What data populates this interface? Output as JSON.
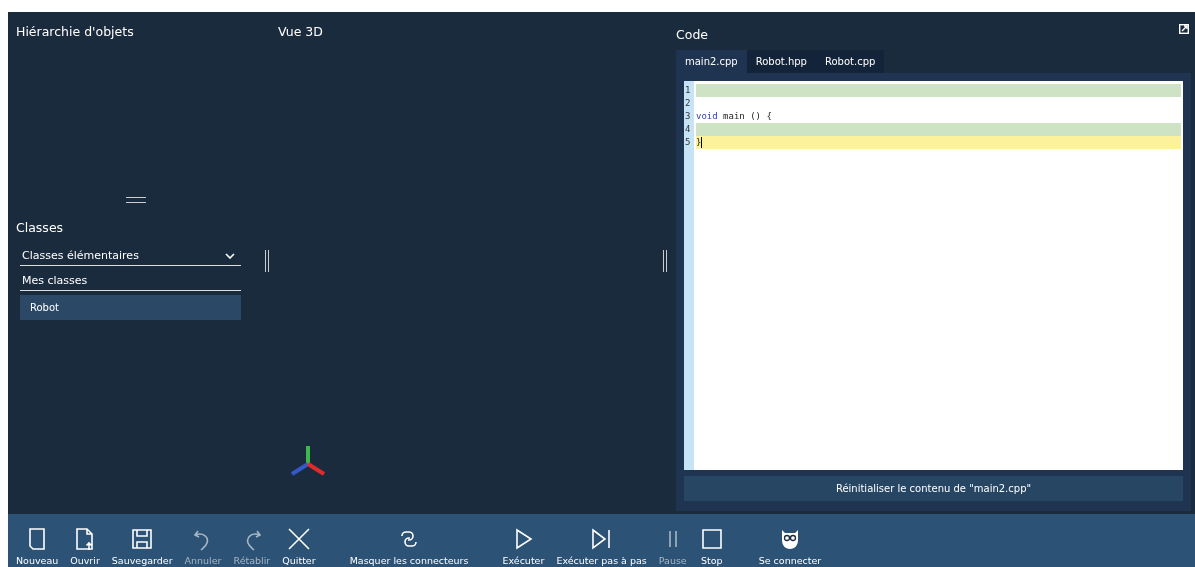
{
  "hierarchy": {
    "title": "Hiérarchie d'objets"
  },
  "classes": {
    "title": "Classes",
    "dropdown": {
      "value": "Classes élémentaires"
    },
    "section": "Mes classes",
    "items": [
      {
        "label": "Robot",
        "selected": true
      }
    ]
  },
  "view3d": {
    "title": "Vue 3D"
  },
  "code": {
    "title": "Code",
    "tabs": [
      {
        "label": "main2.cpp",
        "selected": true
      },
      {
        "label": "Robot.hpp",
        "selected": false
      },
      {
        "label": "Robot.cpp",
        "selected": false
      }
    ],
    "lines": [
      {
        "number": "1",
        "color": "#cde3c3"
      },
      {
        "number": "2"
      },
      {
        "number": "3",
        "tokens": [
          {
            "text": "void",
            "kind": "keyword"
          },
          {
            "text": " main () {",
            "kind": "plain"
          }
        ]
      },
      {
        "number": "4",
        "color": "#cde3c3"
      },
      {
        "number": "5",
        "color": "#fbf29b",
        "cursor": true,
        "tokens": [
          {
            "text": "}",
            "kind": "plain"
          }
        ]
      }
    ],
    "reset_button": "Réinitialiser le contenu de \"main2.cpp\""
  },
  "toolbar": [
    {
      "label": "Nouveau",
      "disabled": false
    },
    {
      "label": "Ouvrir",
      "disabled": false
    },
    {
      "label": "Sauvegarder",
      "disabled": false
    },
    {
      "label": "Annuler",
      "disabled": true
    },
    {
      "label": "Rétablir",
      "disabled": true
    },
    {
      "label": "Quitter",
      "disabled": false
    },
    {
      "label": "Masquer les connecteurs",
      "disabled": false
    },
    {
      "label": "Exécuter",
      "disabled": false
    },
    {
      "label": "Exécuter pas à pas",
      "disabled": false
    },
    {
      "label": "Pause",
      "disabled": true
    },
    {
      "label": "Stop",
      "disabled": false
    },
    {
      "label": "Se connecter",
      "disabled": false
    }
  ]
}
